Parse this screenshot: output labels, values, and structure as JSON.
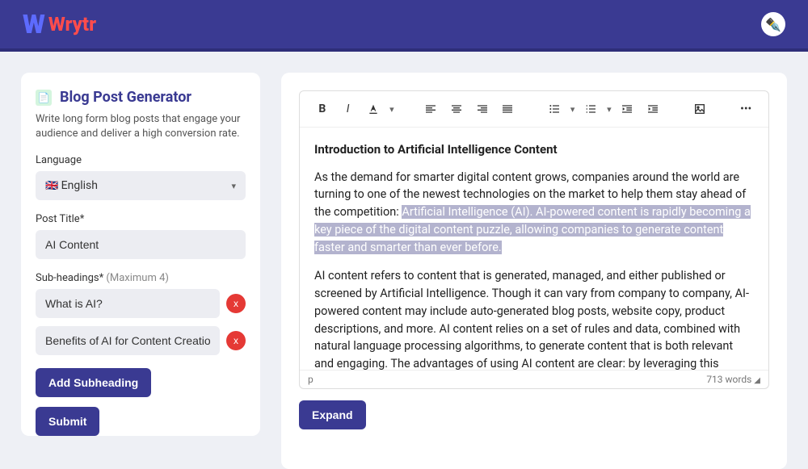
{
  "app": {
    "name": "Wrytr",
    "logo_letter": "W"
  },
  "sidebar": {
    "title": "Blog Post Generator",
    "desc": "Write long form blog posts that engage your audience and deliver a high conversion rate.",
    "language_label": "Language",
    "language_value": "English",
    "post_title_label": "Post Title*",
    "post_title_value": "AI Content",
    "subheadings_label": "Sub-headings*",
    "subheadings_max": "(Maximum 4)",
    "subheadings": [
      "What is AI?",
      "Benefits of AI for Content Creation"
    ],
    "add_subheading": "Add Subheading",
    "submit": "Submit"
  },
  "editor": {
    "heading": "Introduction to Artificial Intelligence Content",
    "para1_a": "As the demand for smarter digital content grows, companies around the world are turning to one of the newest technologies on the market to help them stay ahead of the competition: ",
    "para1_hl": "Artificial Intelligence (AI). AI-powered content is rapidly becoming a key piece of the digital content puzzle, allowing companies to generate content faster and smarter than ever before.",
    "para2": "AI content refers to content that is generated, managed, and either published or screened by Artificial Intelligence. Though it can vary from company to company, AI-powered content may include auto-generated blog posts, website copy, product descriptions, and more. AI content relies on a set of rules and data, combined with natural language processing algorithms, to generate content that is both relevant and engaging. The advantages of using AI content are clear: by leveraging this technology, businesses can save time and resources while still producing high-quality, optimized content that speaks directly to their target audience. Thanks to AI, businesses can also focus on generating more engaging and accurate content, as AI helps to reduce the risk of errors and typos",
    "footer_path": "p",
    "word_count": "713 words",
    "expand": "Expand"
  }
}
